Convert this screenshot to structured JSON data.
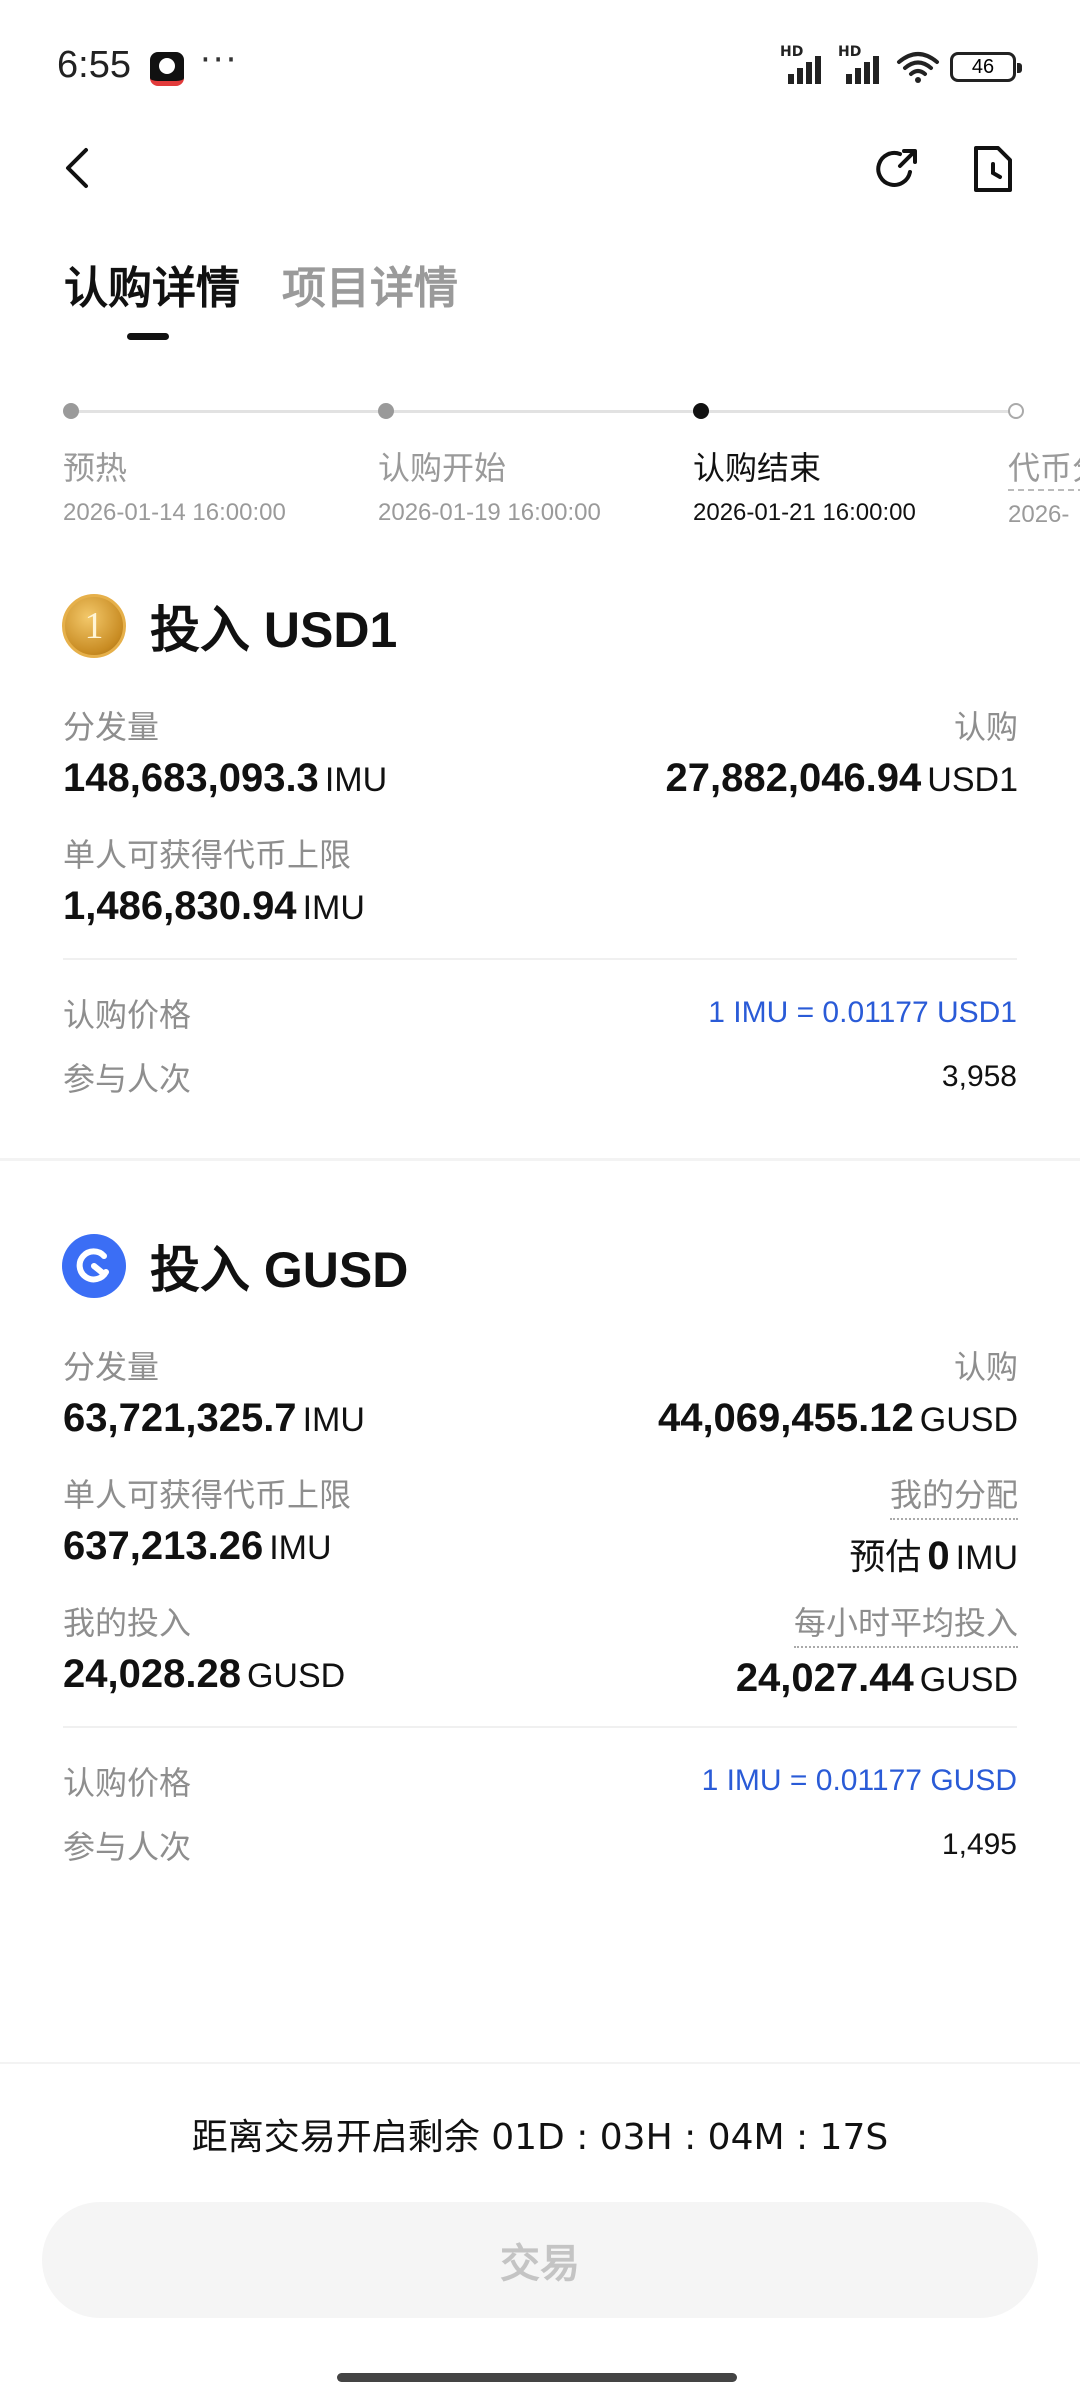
{
  "status_bar": {
    "time": "6:55",
    "more": "···",
    "signal1_tag": "HD",
    "signal2_tag": "HD",
    "battery": "46"
  },
  "tabs": [
    {
      "label": "认购详情",
      "active": true
    },
    {
      "label": "项目详情",
      "active": false
    }
  ],
  "timeline": [
    {
      "label": "预热",
      "date": "2026-01-14 16:00:00",
      "state": "done"
    },
    {
      "label": "认购开始",
      "date": "2026-01-19 16:00:00",
      "state": "done"
    },
    {
      "label": "认购结束",
      "date": "2026-01-21 16:00:00",
      "state": "current"
    },
    {
      "label": "代币分",
      "date": "2026-",
      "state": "future"
    }
  ],
  "section_usd1": {
    "coin_symbol": "1",
    "title": "投入 USD1",
    "distribution_label": "分发量",
    "distribution_value": "148,683,093.3",
    "distribution_unit": "IMU",
    "subscribed_label": "认购",
    "subscribed_value": "27,882,046.94",
    "subscribed_unit": "USD1",
    "cap_label": "单人可获得代币上限",
    "cap_value": "1,486,830.94",
    "cap_unit": "IMU",
    "price_label": "认购价格",
    "price_value": "1 IMU = 0.01177 USD1",
    "participants_label": "参与人次",
    "participants_value": "3,958"
  },
  "section_gusd": {
    "title": "投入 GUSD",
    "distribution_label": "分发量",
    "distribution_value": "63,721,325.7",
    "distribution_unit": "IMU",
    "subscribed_label": "认购",
    "subscribed_value": "44,069,455.12",
    "subscribed_unit": "GUSD",
    "cap_label": "单人可获得代币上限",
    "cap_value": "637,213.26",
    "cap_unit": "IMU",
    "allocation_label": "我的分配",
    "allocation_prefix": "预估",
    "allocation_value": "0",
    "allocation_unit": "IMU",
    "my_input_label": "我的投入",
    "my_input_value": "24,028.28",
    "my_input_unit": "GUSD",
    "hourly_label": "每小时平均投入",
    "hourly_value": "24,027.44",
    "hourly_unit": "GUSD",
    "price_label": "认购价格",
    "price_value": "1 IMU = 0.01177 GUSD",
    "participants_label": "参与人次",
    "participants_value": "1,495"
  },
  "bottom": {
    "countdown": "距离交易开启剩余 01D : 03H : 04M : 17S",
    "trade_button": "交易"
  },
  "colors": {
    "link_blue": "#2a5bd7",
    "gusd_blue": "#3b6ef5",
    "muted": "#8e8e8e"
  }
}
